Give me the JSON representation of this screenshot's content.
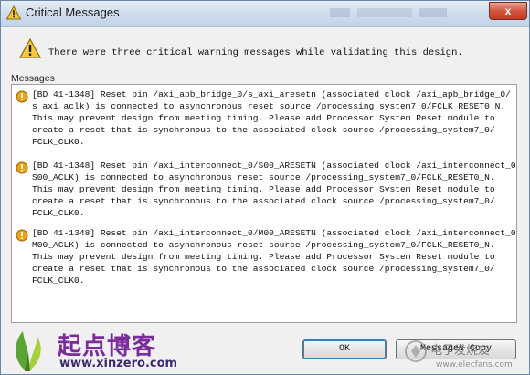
{
  "window": {
    "title": "Critical Messages",
    "close_glyph": "x"
  },
  "header": {
    "text": "There were three critical warning messages while validating this design."
  },
  "messages_group": {
    "label": "Messages",
    "items": [
      {
        "icon": "warning-icon",
        "lines": [
          "[BD 41-1348] Reset pin /axi_apb_bridge_0/s_axi_aresetn (associated clock /axi_apb_bridge_0/",
          "s_axi_aclk) is connected to asynchronous reset source /processing_system7_0/FCLK_RESET0_N.",
          "This may prevent design from meeting timing. Please add Processor System Reset module to",
          "create a reset that is synchronous to the associated clock source /processing_system7_0/",
          "FCLK_CLK0."
        ]
      },
      {
        "icon": "warning-icon",
        "lines": [
          "[BD 41-1348] Reset pin /axi_interconnect_0/S00_ARESETN (associated clock /axi_interconnect_0/",
          "S00_ACLK) is connected to asynchronous reset source /processing_system7_0/FCLK_RESET0_N.",
          "This may prevent design from meeting timing. Please add Processor System Reset module to",
          "create a reset that is synchronous to the associated clock source /processing_system7_0/",
          "FCLK_CLK0."
        ]
      },
      {
        "icon": "warning-icon",
        "lines": [
          "[BD 41-1348] Reset pin /axi_interconnect_0/M00_ARESETN (associated clock /axi_interconnect_0/",
          "M00_ACLK) is connected to asynchronous reset source /processing_system7_0/FCLK_RESET0_N.",
          "This may prevent design from meeting timing. Please add Processor System Reset module to",
          "create a reset that is synchronous to the associated clock source /processing_system7_0/",
          "FCLK_CLK0."
        ]
      }
    ]
  },
  "buttons": {
    "ok_label": "OK",
    "copy_label": "Messages Copy"
  },
  "watermark": {
    "left_brand": "起点博客",
    "left_url": "www.xinzero.com",
    "right_brand": "电子发烧友",
    "right_url": "www.elecfans.com"
  },
  "colors": {
    "title_gradient_top": "#e6eef8",
    "close_red": "#c33b22",
    "warning_orange": "#e8a317",
    "brand_purple": "#7a2c9a"
  }
}
